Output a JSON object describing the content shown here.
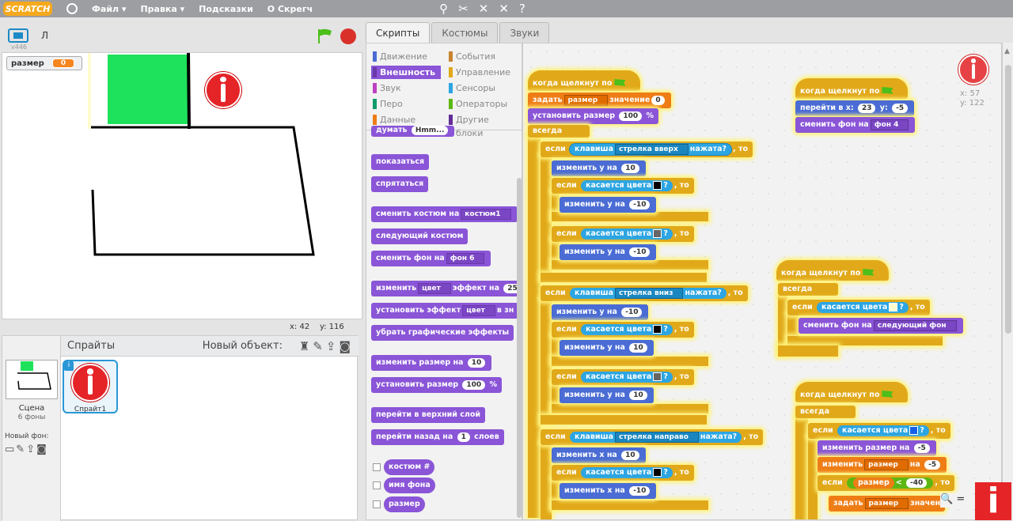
{
  "topbar": {
    "logo": "SCRATCH",
    "menus": [
      "Файл ▾",
      "Правка ▾",
      "Подсказки",
      "О Скрегч"
    ]
  },
  "stage": {
    "version": "v446",
    "sprite_name": "Л",
    "monitor": {
      "label": "размер",
      "value": "0"
    },
    "coords": {
      "x_label": "x:",
      "x": "42",
      "y_label": "y:",
      "y": "116"
    }
  },
  "sprites": {
    "title": "Спрайты",
    "new_object": "Новый объект:",
    "scene_label": "Сцена",
    "scene_count": "6 фоны",
    "new_backdrop": "Новый фон:",
    "sprite1": "Спрайт1"
  },
  "tabs": [
    "Скрипты",
    "Костюмы",
    "Звуки"
  ],
  "categories": {
    "left": [
      "Движение",
      "Внешность",
      "Звук",
      "Перо",
      "Данные"
    ],
    "right": [
      "События",
      "Управление",
      "Сенсоры",
      "Операторы",
      "Другие блоки"
    ],
    "colors": {
      "motion": "#4a6cd4",
      "looks": "#8a55d7",
      "sound": "#bb42c3",
      "pen": "#0e9a6c",
      "data": "#ee7d16",
      "events": "#c88330",
      "control": "#e1a91a",
      "sensing": "#2ca5e2",
      "operators": "#5cb712",
      "more": "#632d99"
    }
  },
  "palette": {
    "think_partial": "думать",
    "show": "показаться",
    "hide": "спрятаться",
    "switch_costume": "сменить костюм на",
    "costume1": "костюм1",
    "next_costume": "следующий костюм",
    "switch_backdrop": "сменить фон на",
    "backdrop6": "фон 6",
    "change_effect": "изменить",
    "effect_color": "цвет",
    "effect_by": "эффект на",
    "effect_val": "25",
    "set_effect": "установить эффект",
    "set_effect_to": "в зн",
    "clear_effects": "убрать графические эффекты",
    "change_size": "изменить размер на",
    "change_size_val": "10",
    "set_size": "установить размер",
    "set_size_val": "100",
    "percent": "%",
    "go_front": "перейти в верхний слой",
    "go_back": "перейти назад на",
    "go_back_val": "1",
    "layers": "слоев",
    "rep_costume": "костюм #",
    "rep_backdrop": "имя фона",
    "rep_size": "размер"
  },
  "script": {
    "mouse_x": "x: 57",
    "mouse_y": "y: 122",
    "when_flag": "когда щелкнут по",
    "set_var": "задать",
    "var_size": "размер",
    "value_word": "значение",
    "zero": "0",
    "set_size": "установить размер",
    "hundred": "100",
    "percent": "%",
    "forever": "всегда",
    "if": "если",
    "then": ", то",
    "key": "клавиша",
    "pressed": "нажата?",
    "key_up": "стрелка вверх",
    "key_down": "стрелка вниз",
    "key_right": "стрелка направо",
    "change_y": "изменить y на",
    "change_x": "изменить x на",
    "touching_color": "касается цвета",
    "q": "?",
    "v10": "10",
    "vm10": "-10",
    "goto_x": "перейти в x:",
    "goto_y": "y:",
    "x23": "23",
    "ym5": "-5",
    "switch_bg": "сменить фон на",
    "bg4": "фон 4",
    "next_bg": "следующий фон",
    "change_size": "изменить размер на",
    "m5": "-5",
    "change_var": "изменить",
    "by": "на",
    "size_rep": "размер",
    "lt": "<",
    "m40": "-40",
    "set_partial": "задать",
    "value_partial": "значен"
  }
}
